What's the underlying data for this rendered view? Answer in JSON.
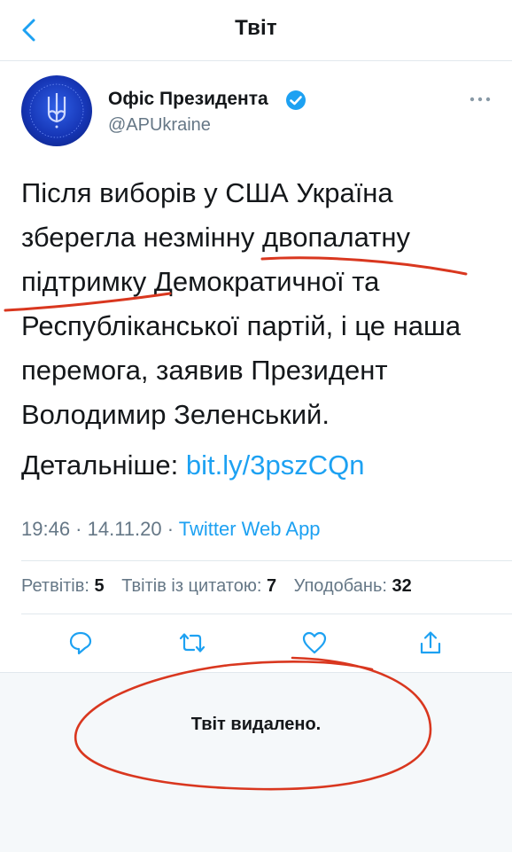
{
  "header": {
    "title": "Твіт",
    "back_icon": "chevron-left-icon"
  },
  "tweet": {
    "author_name": "Офіс Президента",
    "author_handle": "@APUkraine",
    "verified": true,
    "text": "Після виборів у США Україна зберегла незмінну двопалатну підтримку Демократичної та Республіканської партій, і це наша перемога, заявив Президент Володимир Зеленський.",
    "more_label": "Детальніше:",
    "link": "bit.ly/3pszCQn",
    "time": "19:46 · 14.11.20 ·",
    "app": "Twitter Web App"
  },
  "stats": {
    "retweets_label": "Ретвітів:",
    "retweets": "5",
    "quotes_label": "Твітів із цитатою:",
    "quotes": "7",
    "likes_label": "Уподобань:",
    "likes": "32"
  },
  "actions": [
    "reply-icon",
    "retweet-icon",
    "like-icon",
    "share-icon"
  ],
  "deleted_notice": "Твіт видалено.",
  "colors": {
    "accent": "#1da1f2",
    "annotation": "#d9371f",
    "avatar": "#1636b6"
  }
}
